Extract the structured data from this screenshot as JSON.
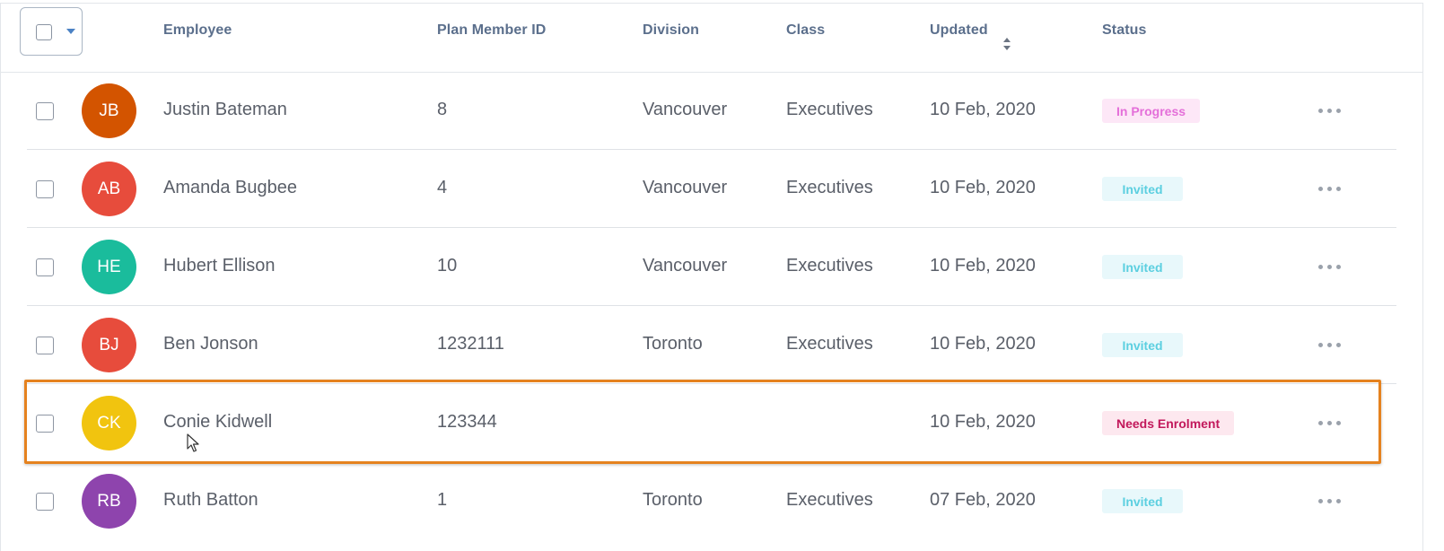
{
  "table": {
    "headers": {
      "employee": "Employee",
      "plan_member_id": "Plan Member ID",
      "division": "Division",
      "class": "Class",
      "updated": "Updated",
      "status": "Status"
    },
    "rows": [
      {
        "initials": "JB",
        "avatar_color": "#d35400",
        "name": "Justin Bateman",
        "plan_member_id": "8",
        "division": "Vancouver",
        "class": "Executives",
        "updated": "10 Feb, 2020",
        "status": "In Progress",
        "status_style": "progress"
      },
      {
        "initials": "AB",
        "avatar_color": "#e74c3c",
        "name": "Amanda Bugbee",
        "plan_member_id": "4",
        "division": "Vancouver",
        "class": "Executives",
        "updated": "10 Feb, 2020",
        "status": "Invited",
        "status_style": "invited"
      },
      {
        "initials": "HE",
        "avatar_color": "#1abc9c",
        "name": "Hubert Ellison",
        "plan_member_id": "10",
        "division": "Vancouver",
        "class": "Executives",
        "updated": "10 Feb, 2020",
        "status": "Invited",
        "status_style": "invited"
      },
      {
        "initials": "BJ",
        "avatar_color": "#e74c3c",
        "name": "Ben Jonson",
        "plan_member_id": "1232111",
        "division": "Toronto",
        "class": "Executives",
        "updated": "10 Feb, 2020",
        "status": "Invited",
        "status_style": "invited"
      },
      {
        "initials": "CK",
        "avatar_color": "#f1c40f",
        "name": "Conie Kidwell",
        "plan_member_id": "123344",
        "division": "",
        "class": "",
        "updated": "10 Feb, 2020",
        "status": "Needs Enrolment",
        "status_style": "needs"
      },
      {
        "initials": "RB",
        "avatar_color": "#8e44ad",
        "name": "Ruth Batton",
        "plan_member_id": "1",
        "division": "Toronto",
        "class": "Executives",
        "updated": "07 Feb, 2020",
        "status": "Invited",
        "status_style": "invited"
      }
    ]
  },
  "status_styles": {
    "progress": {
      "bg": "#fde7f7",
      "fg": "#e46fd9"
    },
    "invited": {
      "bg": "#e8f8fb",
      "fg": "#5ccfe0"
    },
    "needs": {
      "bg": "#fde8ef",
      "fg": "#c2185b"
    }
  },
  "highlight_color": "#e5821f",
  "icons": {
    "select_all_caret": "chevron-down-icon",
    "sort": "sort-icon",
    "row_menu": "more-horizontal-icon",
    "cursor": "mouse-pointer-icon"
  }
}
